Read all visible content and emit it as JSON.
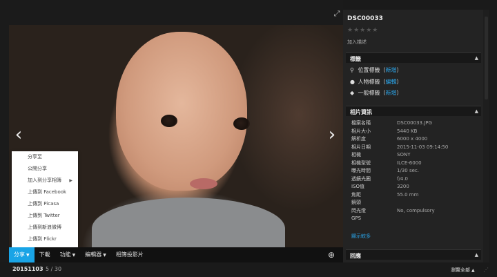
{
  "viewer": {
    "expand_icon": "expand-icon",
    "prev_glyph": "‹",
    "next_glyph": "›"
  },
  "share_menu": {
    "items": [
      {
        "label": "分享至"
      },
      {
        "label": "公開分享"
      },
      {
        "label": "加入到分享相簿",
        "has_submenu": true
      },
      {
        "label": "上傳到 Facebook"
      },
      {
        "label": "上傳到 Picasa"
      },
      {
        "label": "上傳到 Twitter"
      },
      {
        "label": "上傳到新浪微博"
      },
      {
        "label": "上傳到 Flickr"
      }
    ]
  },
  "toolbar": {
    "share": "分享",
    "download": "下載",
    "function": "功能",
    "editor": "編輯器",
    "slideshow": "相簿投影片"
  },
  "bottom": {
    "date": "20151103",
    "counter": "5 / 30",
    "browse_all": "瀏覽全部"
  },
  "panel": {
    "title": "DSC00033",
    "rating": 0,
    "stars": "★★★★★",
    "add_description": "加入描述",
    "tags_section": "標籤",
    "tags": {
      "location": {
        "label": "位置標籤（",
        "link": "新增",
        "end": "）"
      },
      "person": {
        "label": "人物標籤（",
        "link": "編輯",
        "end": "）"
      },
      "general": {
        "label": "一般標籤（",
        "link": "新增",
        "end": "）"
      }
    },
    "info_section": "相片資訊",
    "info": [
      {
        "k": "檔案名稱",
        "v": "DSC00033.JPG"
      },
      {
        "k": "相片大小",
        "v": "5440 KB"
      },
      {
        "k": "解析度",
        "v": "6000 x 4000"
      },
      {
        "k": "相片日期",
        "v": "2015-11-03 09:14:50"
      },
      {
        "k": "相機",
        "v": "SONY"
      },
      {
        "k": "相機型號",
        "v": "ILCE-6000"
      },
      {
        "k": "曝光時間",
        "v": "1/30 sec."
      },
      {
        "k": "透鏡光圈",
        "v": "f/4.0"
      },
      {
        "k": "ISO值",
        "v": "3200"
      },
      {
        "k": "焦距",
        "v": "55.0 mm"
      },
      {
        "k": "鏡頭",
        "v": ""
      },
      {
        "k": "閃光燈",
        "v": "No, compulsory"
      },
      {
        "k": "GPS",
        "v": ""
      }
    ],
    "show_more": "顯示較多",
    "reply_section": "回應"
  },
  "colors": {
    "accent": "#19a4e6",
    "link": "#2aa5ea",
    "panel": "#232323"
  }
}
